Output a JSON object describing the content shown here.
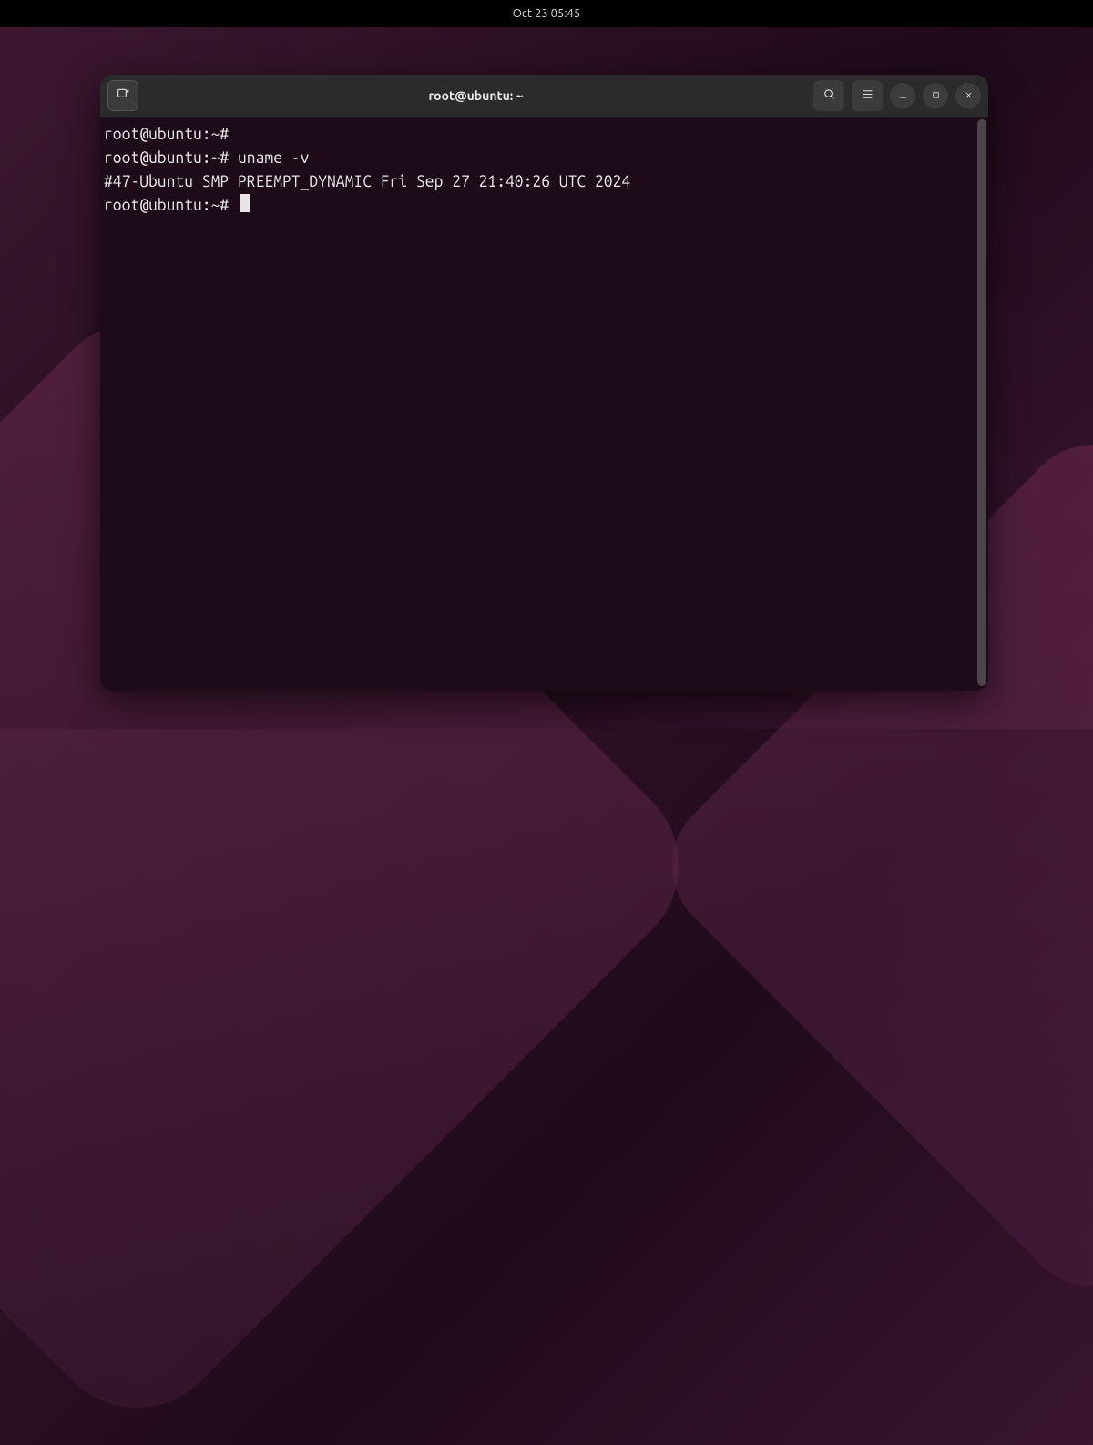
{
  "topbar": {
    "clock": "Oct 23  05:45"
  },
  "window": {
    "title": "root@ubuntu: ~"
  },
  "terminal": {
    "lines": [
      {
        "prompt": "root@ubuntu:~#",
        "cmd": ""
      },
      {
        "prompt": "root@ubuntu:~#",
        "cmd": " uname -v"
      },
      {
        "output": "#47-Ubuntu SMP PREEMPT_DYNAMIC Fri Sep 27 21:40:26 UTC 2024"
      },
      {
        "prompt": "root@ubuntu:~#",
        "cmd": " ",
        "cursor": true
      }
    ]
  }
}
